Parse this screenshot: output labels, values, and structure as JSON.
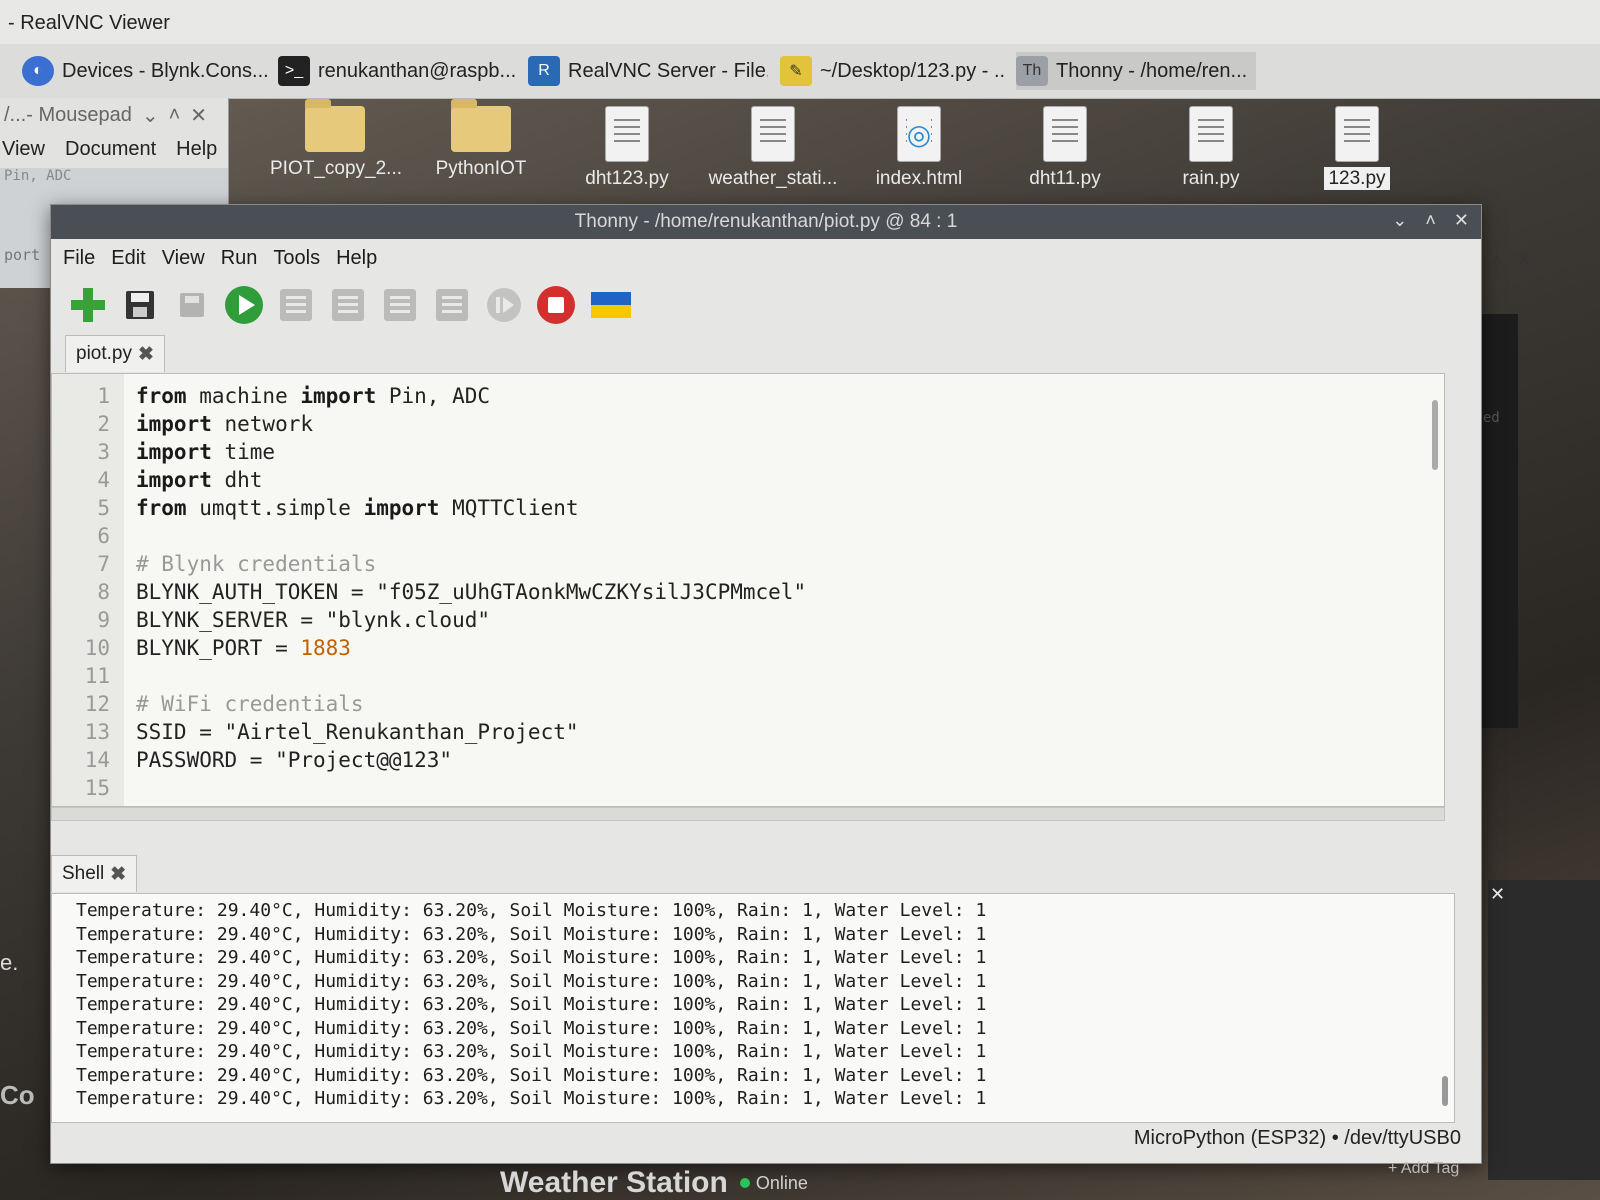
{
  "vnc": {
    "title": "- RealVNC Viewer"
  },
  "taskbar": {
    "items": [
      {
        "label": "Devices - Blynk.Cons..."
      },
      {
        "label": "renukanthan@raspb..."
      },
      {
        "label": "RealVNC Server - File..."
      },
      {
        "label": "~/Desktop/123.py - ..."
      },
      {
        "label": "Thonny  -  /home/ren..."
      }
    ]
  },
  "mousepad": {
    "title": "/...- Mousepad",
    "menu": [
      "View",
      "Document",
      "Help"
    ],
    "code_fragment": "Pin, ADC",
    "left_fragment": "port"
  },
  "desktop": {
    "icons": [
      {
        "label": "PIOT_copy_2...",
        "kind": "folder"
      },
      {
        "label": "PythonIOT",
        "kind": "folder"
      },
      {
        "label": "dht123.py",
        "kind": "doc"
      },
      {
        "label": "weather_stati...",
        "kind": "doc"
      },
      {
        "label": "index.html",
        "kind": "html"
      },
      {
        "label": "dht11.py",
        "kind": "doc"
      },
      {
        "label": "rain.py",
        "kind": "doc"
      },
      {
        "label": "123.py",
        "kind": "doc"
      }
    ]
  },
  "thonny": {
    "title": "Thonny  -  /home/renukanthan/piot.py  @  84 : 1",
    "menu": [
      "File",
      "Edit",
      "View",
      "Run",
      "Tools",
      "Help"
    ],
    "editor_tab": "piot.py",
    "code": [
      {
        "n": "1",
        "text": "from machine import Pin, ADC"
      },
      {
        "n": "2",
        "text": "import network"
      },
      {
        "n": "3",
        "text": "import time"
      },
      {
        "n": "4",
        "text": "import dht"
      },
      {
        "n": "5",
        "text": "from umqtt.simple import MQTTClient"
      },
      {
        "n": "6",
        "text": ""
      },
      {
        "n": "7",
        "text": "# Blynk credentials"
      },
      {
        "n": "8",
        "text": "BLYNK_AUTH_TOKEN = \"f05Z_uUhGTAonkMwCZKYsilJ3CPMmcel\""
      },
      {
        "n": "9",
        "text": "BLYNK_SERVER = \"blynk.cloud\""
      },
      {
        "n": "10",
        "text": "BLYNK_PORT = 1883"
      },
      {
        "n": "11",
        "text": ""
      },
      {
        "n": "12",
        "text": "# WiFi credentials"
      },
      {
        "n": "13",
        "text": "SSID = \"Airtel_Renukanthan_Project\""
      },
      {
        "n": "14",
        "text": "PASSWORD = \"Project@@123\""
      },
      {
        "n": "15",
        "text": ""
      }
    ],
    "shell_tab": "Shell",
    "shell_lines": [
      "Temperature: 29.40°C, Humidity: 63.20%, Soil Moisture: 100%, Rain: 1, Water Level: 1",
      "Temperature: 29.40°C, Humidity: 63.20%, Soil Moisture: 100%, Rain: 1, Water Level: 1",
      "Temperature: 29.40°C, Humidity: 63.20%, Soil Moisture: 100%, Rain: 1, Water Level: 1",
      "Temperature: 29.40°C, Humidity: 63.20%, Soil Moisture: 100%, Rain: 1, Water Level: 1",
      "Temperature: 29.40°C, Humidity: 63.20%, Soil Moisture: 100%, Rain: 1, Water Level: 1",
      "Temperature: 29.40°C, Humidity: 63.20%, Soil Moisture: 100%, Rain: 1, Water Level: 1",
      "Temperature: 29.40°C, Humidity: 63.20%, Soil Moisture: 100%, Rain: 1, Water Level: 1",
      "Temperature: 29.40°C, Humidity: 63.20%, Soil Moisture: 100%, Rain: 1, Water Level: 1",
      "Temperature: 29.40°C, Humidity: 63.20%, Soil Moisture: 100%, Rain: 1, Water Level: 1"
    ],
    "status": "MicroPython (ESP32)  •  /dev/ttyUSB0",
    "toolbar_icons": [
      "new-file-icon",
      "save-icon",
      "load-icon",
      "run-icon",
      "debug-icon",
      "step-over-icon",
      "step-into-icon",
      "step-out-icon",
      "resume-icon",
      "stop-icon",
      "ukraine-flag-icon"
    ]
  },
  "background": {
    "blynk_title": "Weather Station",
    "blynk_status": "Online",
    "add_tag": "+ Add Tag",
    "right_fragment": "ired",
    "left_fragment_1": "e.",
    "left_fragment_2": "Co"
  },
  "colors": {
    "run_green": "#2e9d3a",
    "stop_red": "#d32f2f",
    "number_orange": "#c06000",
    "online_green": "#27c45a"
  }
}
